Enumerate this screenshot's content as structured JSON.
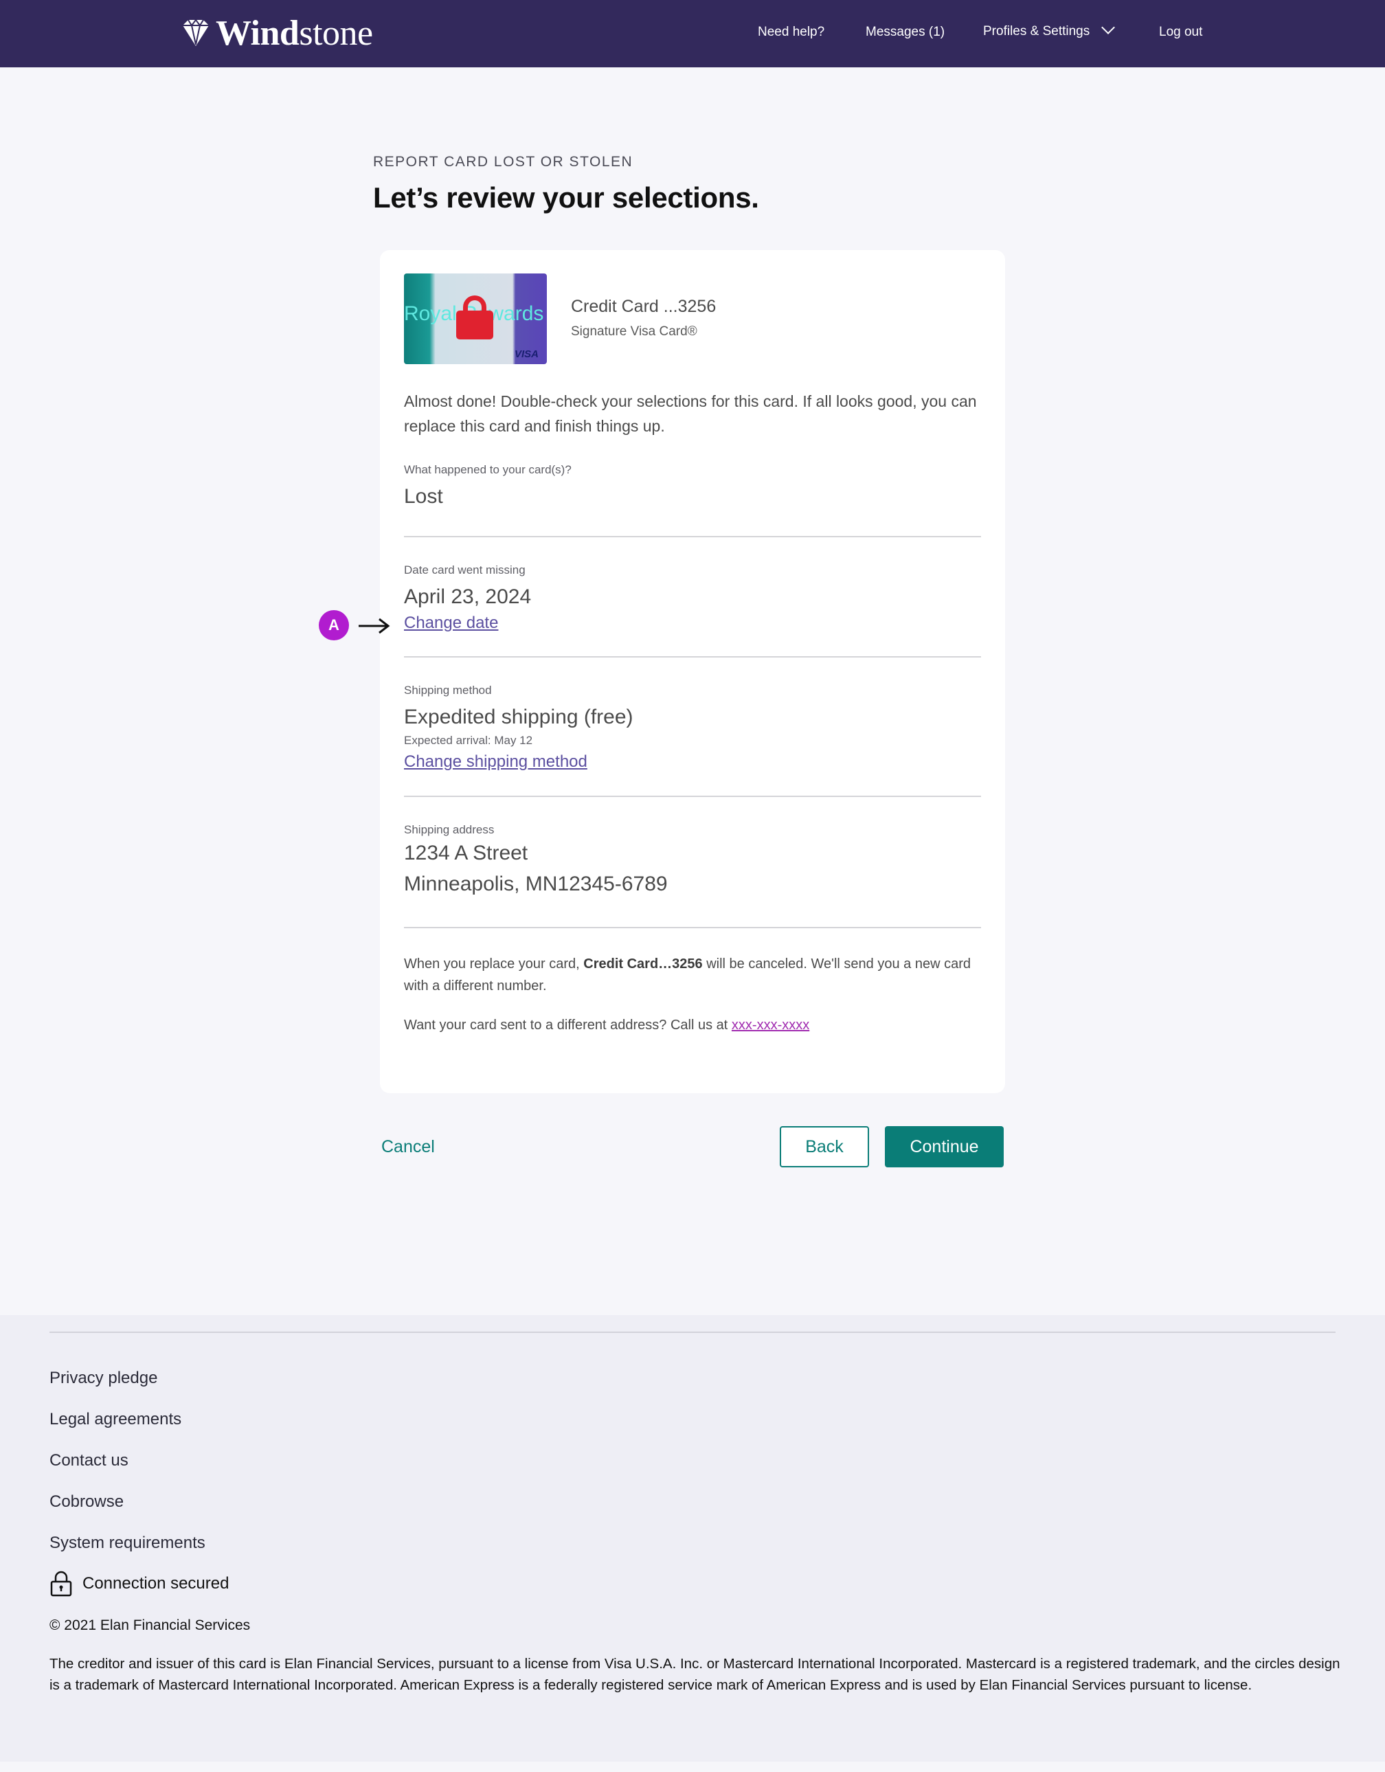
{
  "header": {
    "brand_bold": "Wind",
    "brand_light": "stone",
    "nav": {
      "help": "Need help?",
      "messages": "Messages (1)",
      "profiles": "Profiles & Settings",
      "logout": "Log out"
    }
  },
  "page": {
    "eyebrow": "REPORT CARD LOST OR STOLEN",
    "title": "Let’s review your selections."
  },
  "card": {
    "image_text": "Royal Rewards",
    "network": "VISA",
    "name": "Credit Card ...3256",
    "type": "Signature Visa Card®"
  },
  "intro": "Almost done! Double-check your selections for this card. If all looks good, you can replace this card and finish things up.",
  "fields": {
    "what_happened": {
      "label": "What happened to your card(s)?",
      "value": "Lost"
    },
    "date_missing": {
      "label": "Date card went missing",
      "value": "April 23, 2024",
      "link": "Change date"
    },
    "shipping_method": {
      "label": "Shipping method",
      "value": "Expedited shipping (free)",
      "sub": "Expected arrival: May 12",
      "link": "Change shipping method"
    },
    "shipping_address": {
      "label": "Shipping address",
      "line1": "1234 A Street",
      "line2": "Minneapolis, MN12345-6789"
    }
  },
  "notes": {
    "replace_pre": "When you replace your card, ",
    "replace_bold": "Credit Card…3256",
    "replace_post": " will be canceled. We'll send you a new card with a different number.",
    "address_pre": "Want your card sent to a different address? Call us at ",
    "phone": "xxx-xxx-xxxx"
  },
  "annotation": {
    "marker": "A"
  },
  "actions": {
    "cancel": "Cancel",
    "back": "Back",
    "continue": "Continue"
  },
  "footer": {
    "links": [
      "Privacy pledge",
      "Legal agreements",
      "Contact us",
      "Cobrowse",
      "System requirements"
    ],
    "secure": "Connection secured",
    "copyright": "© 2021 Elan Financial Services",
    "legal": "The creditor and issuer of this card is Elan Financial Services, pursuant to a license from Visa U.S.A. Inc. or Mastercard International Incorporated. Mastercard is a registered trademark, and the circles design is a trademark of Mastercard International Incorporated. American Express is a federally registered service mark of American Express and is used by Elan Financial Services pursuant to license."
  },
  "colors": {
    "header_bg": "#33295c",
    "accent_teal": "#0a7d77",
    "link_purple": "#5b4fa0",
    "marker_magenta": "#b11ccf",
    "phone_link": "#a12cb0"
  },
  "icons": [
    "diamond-logo-icon",
    "chevron-down-icon",
    "arrow-right-icon",
    "lock-icon"
  ]
}
